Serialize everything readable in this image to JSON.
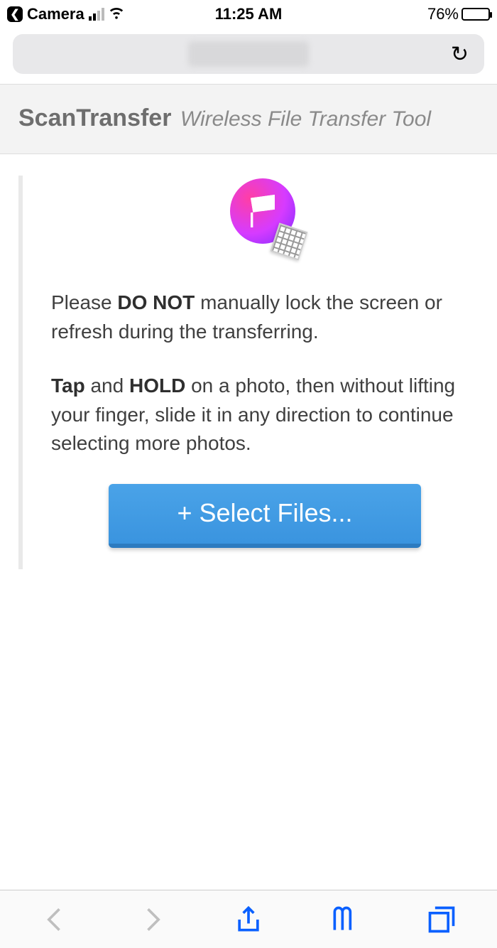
{
  "status": {
    "back_app": "Camera",
    "time": "11:25 AM",
    "battery_pct": "76%"
  },
  "header": {
    "title": "ScanTransfer",
    "subtitle": "Wireless File Transfer Tool"
  },
  "instructions": {
    "p1_pre": "Please ",
    "p1_bold": "DO NOT",
    "p1_post": " manually lock the screen or refresh during the transferring.",
    "p2_b1": "Tap",
    "p2_mid1": " and ",
    "p2_b2": "HOLD",
    "p2_post": " on a photo, then without lifting your finger, slide it in any direction to continue selecting more photos."
  },
  "buttons": {
    "select_files": "+ Select Files..."
  }
}
